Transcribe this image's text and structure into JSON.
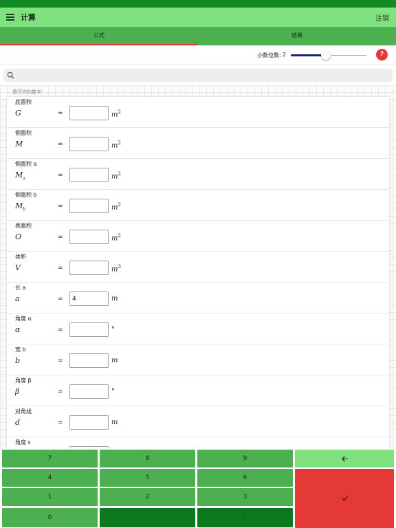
{
  "app": {
    "title": "计算",
    "logout_label": "注销"
  },
  "tabs": [
    {
      "label": "公式",
      "active": true
    },
    {
      "label": "结果",
      "active": false
    }
  ],
  "decimals": {
    "label": "小数位数:",
    "value": "2",
    "slider_fraction": 0.45,
    "help_label": "?"
  },
  "search": {
    "placeholder": ""
  },
  "hint": "填写你的数字:",
  "rows": [
    {
      "label": "底面积",
      "symbol": "G",
      "sub": "",
      "value": "",
      "unit": "m",
      "unit_sup": "2"
    },
    {
      "label": "侧面积",
      "symbol": "M",
      "sub": "",
      "value": "",
      "unit": "m",
      "unit_sup": "2"
    },
    {
      "label": "侧面积 a",
      "symbol": "M",
      "sub": "a",
      "value": "",
      "unit": "m",
      "unit_sup": "2"
    },
    {
      "label": "侧面积 b",
      "symbol": "M",
      "sub": "b",
      "value": "",
      "unit": "m",
      "unit_sup": "2"
    },
    {
      "label": "表面积",
      "symbol": "O",
      "sub": "",
      "value": "",
      "unit": "m",
      "unit_sup": "2"
    },
    {
      "label": "体积",
      "symbol": "V",
      "sub": "",
      "value": "",
      "unit": "m",
      "unit_sup": "3"
    },
    {
      "label": "长 a",
      "symbol": "a",
      "sub": "",
      "value": "4",
      "unit": "m",
      "unit_sup": ""
    },
    {
      "label": "角度 α",
      "symbol": "α",
      "sub": "",
      "value": "",
      "unit": "°",
      "unit_sup": ""
    },
    {
      "label": "宽 b",
      "symbol": "b",
      "sub": "",
      "value": "",
      "unit": "m",
      "unit_sup": ""
    },
    {
      "label": "角度 β",
      "symbol": "β",
      "sub": "",
      "value": "",
      "unit": "°",
      "unit_sup": ""
    },
    {
      "label": "对角线",
      "symbol": "d",
      "sub": "",
      "value": "",
      "unit": "m",
      "unit_sup": ""
    },
    {
      "label": "角度 ε",
      "symbol": "",
      "sub": "",
      "value": "",
      "unit": "",
      "unit_sup": ""
    }
  ],
  "keypad": {
    "keys": [
      {
        "label": "7",
        "name": "key-7",
        "style": "light"
      },
      {
        "label": "8",
        "name": "key-8",
        "style": "light"
      },
      {
        "label": "9",
        "name": "key-9",
        "style": "light"
      },
      {
        "label": "4",
        "name": "key-4",
        "style": "light"
      },
      {
        "label": "5",
        "name": "key-5",
        "style": "light"
      },
      {
        "label": "6",
        "name": "key-6",
        "style": "light"
      },
      {
        "label": "1",
        "name": "key-1",
        "style": "light"
      },
      {
        "label": "2",
        "name": "key-2",
        "style": "light"
      },
      {
        "label": "3",
        "name": "key-3",
        "style": "light"
      },
      {
        "label": "0",
        "name": "key-0",
        "style": "light"
      },
      {
        "label": ".",
        "name": "key-decimal",
        "style": "dark"
      },
      {
        "label": "/",
        "name": "key-divide",
        "style": "dark"
      }
    ],
    "backspace_icon": "arrow-left-icon",
    "confirm_icon": "check-icon"
  },
  "colors": {
    "app_bar": "#80e27e",
    "tab_bar": "#4caf50",
    "status_bar": "#148a24",
    "accent_red": "#e53935",
    "slider": "#1a237e"
  }
}
